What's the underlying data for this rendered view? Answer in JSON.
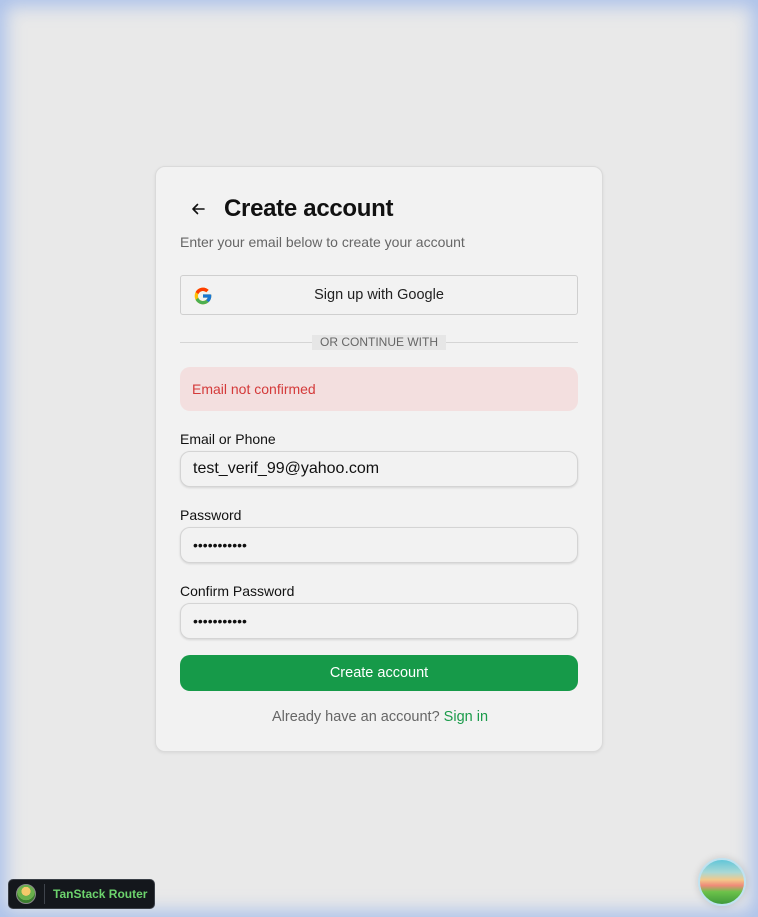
{
  "card": {
    "title": "Create account",
    "subtitle": "Enter your email below to create your account",
    "google_button_label": "Sign up with Google",
    "divider_text": "OR CONTINUE WITH",
    "error_message": "Email not confirmed"
  },
  "form": {
    "email_label": "Email or Phone",
    "email_value": "test_verif_99@yahoo.com",
    "password_label": "Password",
    "password_value": "•••••••••••",
    "confirm_label": "Confirm Password",
    "confirm_value": "•••••••••••",
    "submit_label": "Create account"
  },
  "footer": {
    "prompt": "Already have an account? ",
    "link": "Sign in"
  },
  "devtools": {
    "label": "TanStack Router"
  },
  "icons": {
    "back": "arrow-left-icon",
    "google": "google-icon",
    "devtools_logo": "tanstack-logo-icon",
    "devtools_orb": "tanstack-query-devtools-icon"
  },
  "colors": {
    "primary": "#169a49",
    "error_bg": "#f3dfdf",
    "error_text": "#d43a3a",
    "link": "#1a9b4a"
  }
}
